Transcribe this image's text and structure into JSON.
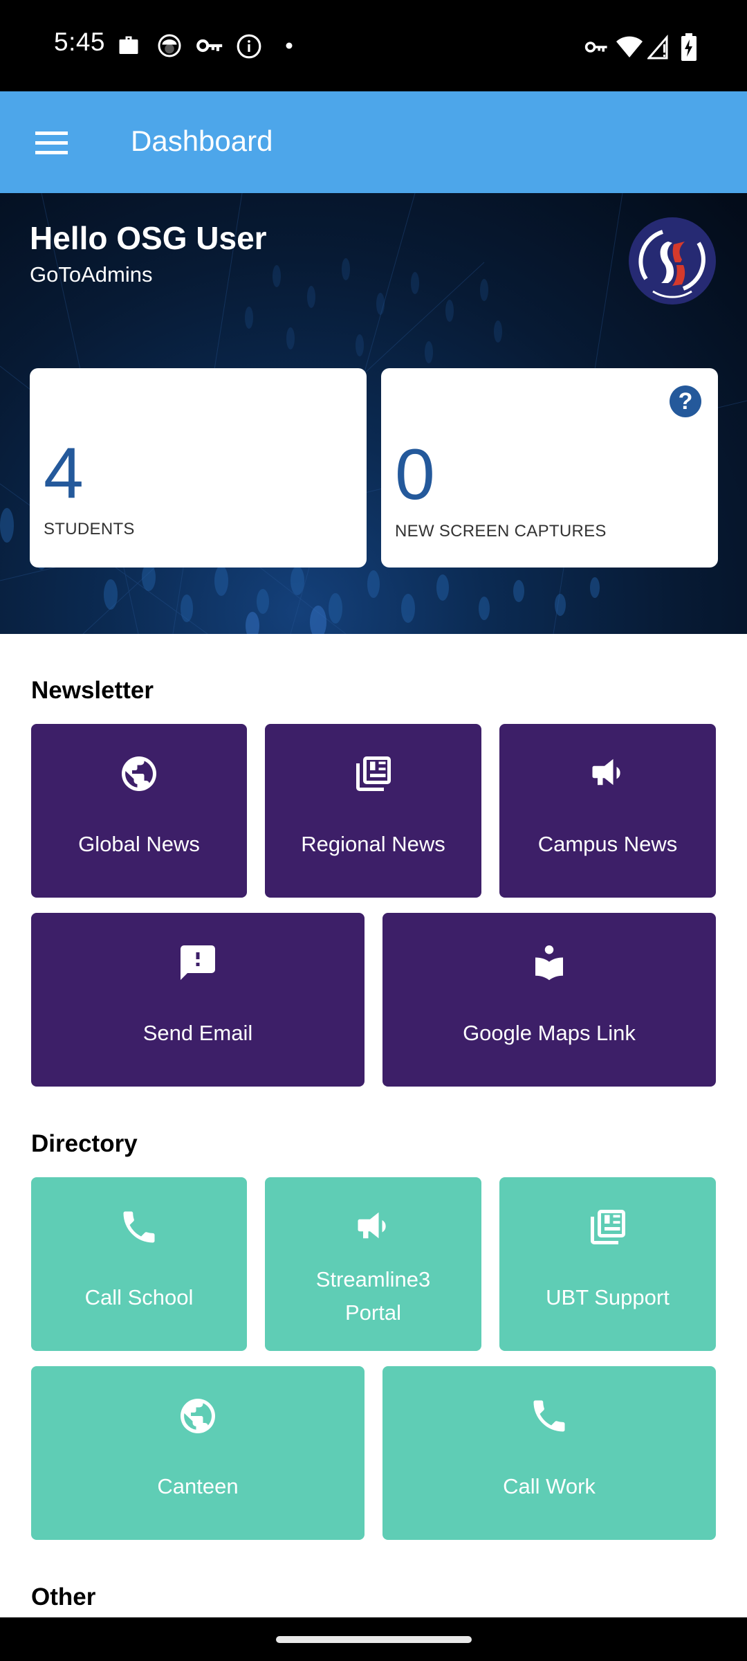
{
  "status_bar": {
    "time": "5:45",
    "left_icons": [
      "work-profile-icon",
      "android-icon",
      "vpn-key-icon",
      "info-icon",
      "notification-dot-icon"
    ],
    "right_icons": [
      "vpn-key-icon",
      "wifi-icon",
      "cell-signal-alert-icon",
      "battery-charging-icon"
    ]
  },
  "app_bar": {
    "title": "Dashboard",
    "menu_icon": "hamburger-menu-icon",
    "color": "#4da6ea"
  },
  "hero": {
    "greeting": "Hello OSG User",
    "subtitle": "GoToAdmins",
    "logo": "school-logo"
  },
  "stats": [
    {
      "value": "4",
      "label": "STUDENTS"
    },
    {
      "value": "0",
      "label": "NEW SCREEN CAPTURES",
      "help_icon": "help-circle-icon",
      "help_text": "?"
    }
  ],
  "colors": {
    "stat_value": "#24599b",
    "newsletter_tile": "#3d1f68",
    "directory_tile": "#5fcdb5"
  },
  "sections": {
    "newsletter": {
      "title": "Newsletter",
      "tiles": [
        {
          "label": "Global News",
          "icon": "globe-icon"
        },
        {
          "label": "Regional News",
          "icon": "newspaper-icon"
        },
        {
          "label": "Campus News",
          "icon": "megaphone-icon"
        },
        {
          "label": "Send Email",
          "icon": "feedback-icon"
        },
        {
          "label": "Google Maps Link",
          "icon": "reader-book-icon"
        }
      ]
    },
    "directory": {
      "title": "Directory",
      "tiles": [
        {
          "label": "Call School",
          "icon": "phone-icon"
        },
        {
          "label_line1": "Streamline3",
          "label_line2": "Portal",
          "icon": "megaphone-icon"
        },
        {
          "label": "UBT Support",
          "icon": "newspaper-icon"
        },
        {
          "label": "Canteen",
          "icon": "globe-icon"
        },
        {
          "label": "Call Work",
          "icon": "phone-icon"
        }
      ]
    },
    "other": {
      "title": "Other"
    }
  }
}
